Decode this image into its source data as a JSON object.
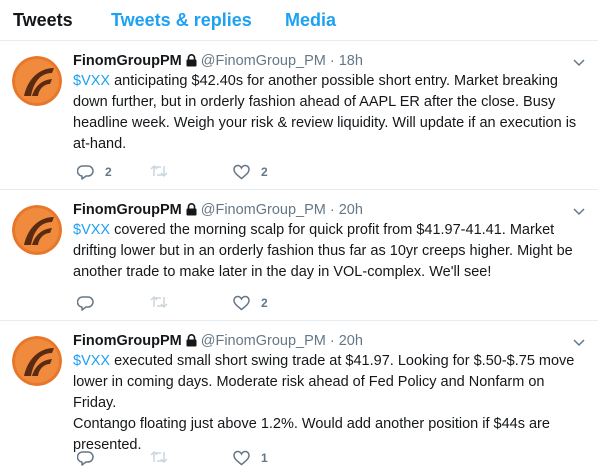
{
  "tabs": [
    {
      "label": "Tweets"
    },
    {
      "label": "Tweets & replies"
    },
    {
      "label": "Media"
    }
  ],
  "tweets": [
    {
      "name": "FinomGroupPM",
      "handle": "@FinomGroup_PM",
      "separator": "·",
      "time": "18h",
      "cashtag": "$VXX",
      "line1": " anticipating $42.40s for another possible short entry. Market breaking",
      "lines": [
        "down further, but in orderly fashion ahead of AAPL ER after the close. Busy",
        "headline week. Weigh your risk & review liquidity. Will update if an execution is",
        "at-hand."
      ],
      "reply_count": "2",
      "retweet_count": "",
      "like_count": "2"
    },
    {
      "name": "FinomGroupPM",
      "handle": "@FinomGroup_PM",
      "separator": "·",
      "time": "20h",
      "cashtag": "$VXX",
      "line1": " covered the morning scalp for quick profit from $41.97-41.41. Market",
      "lines": [
        "drifting lower but in an orderly fashion thus far as 10yr creeps higher. Might be",
        "another trade to make later in the day in VOL-complex. We'll see!"
      ],
      "reply_count": "",
      "retweet_count": "",
      "like_count": "2"
    },
    {
      "name": "FinomGroupPM",
      "handle": "@FinomGroup_PM",
      "separator": "·",
      "time": "20h",
      "cashtag": "$VXX",
      "line1": " executed small short swing trade at $41.97. Looking for $.50-$.75 move",
      "lines": [
        "lower in coming days. Moderate risk ahead of Fed Policy and Nonfarm on Friday.",
        "Contango floating just above 1.2%. Would add another position if $44s are",
        "presented."
      ],
      "reply_count": "",
      "retweet_count": "",
      "like_count": "1"
    }
  ],
  "icons": {
    "reply": "reply-icon",
    "retweet": "retweet-icon",
    "like": "heart-icon",
    "caret": "chevron-down-icon",
    "lock": "lock-icon"
  },
  "colors": {
    "link": "#1da1f2",
    "muted": "#657786",
    "avatar_orange": "#e8762b",
    "avatar_dark": "#5a2a12"
  }
}
